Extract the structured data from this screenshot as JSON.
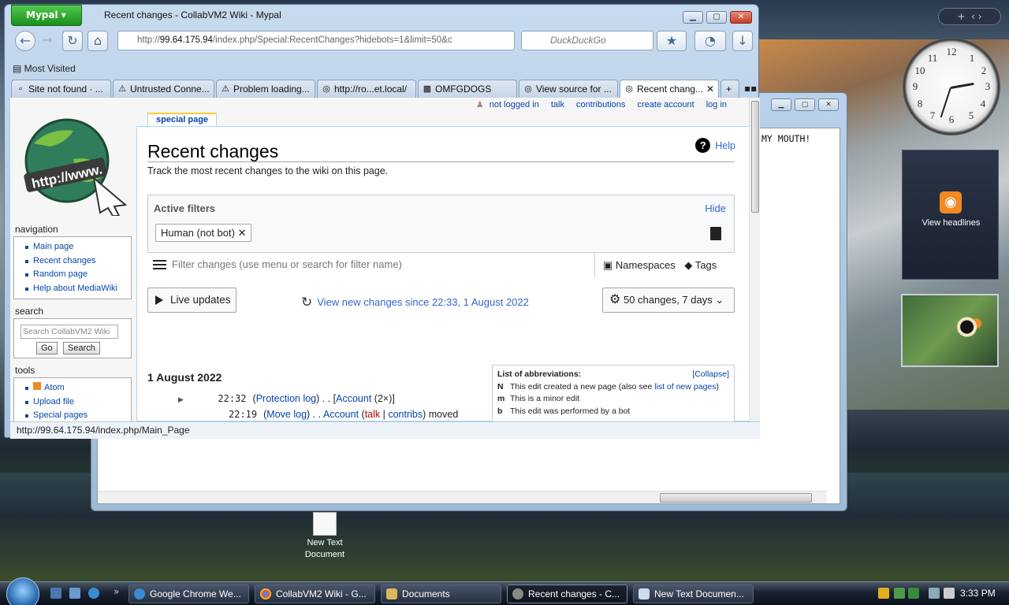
{
  "desktop": {
    "rss_gadget_label": "View headlines",
    "desktop_icon_label_1": "New Text",
    "desktop_icon_label_2": "Document",
    "clock_numerals": [
      "12",
      "1",
      "2",
      "3",
      "4",
      "5",
      "6",
      "7",
      "8",
      "9",
      "10",
      "11"
    ]
  },
  "notepad": {
    "text": "MY MOUTH!"
  },
  "browser": {
    "app_menu": "Mypal",
    "title": "Recent changes - CollabVM2 Wiki - Mypal",
    "url_host": "99.64.175.94",
    "url_prefix": "http://",
    "url_path": "/index.php/Special:RecentChanges?hidebots=1&limit=50&c",
    "search_placeholder": "DuckDuckGo",
    "bookmarks_toolbar": "Most Visited",
    "tabs": [
      {
        "label": "Site not found · ..."
      },
      {
        "label": "Untrusted Conne..."
      },
      {
        "label": "Problem loading..."
      },
      {
        "label": "http://ro...et.local/"
      },
      {
        "label": "OMFGDOGS"
      },
      {
        "label": "View source for ..."
      },
      {
        "label": "Recent chang..."
      }
    ],
    "status_text": "http://99.64.175.94/index.php/Main_Page"
  },
  "wiki": {
    "personal": [
      "not logged in",
      "talk",
      "contributions",
      "create account",
      "log in"
    ],
    "logo_text": "http://www.",
    "special_tab": "special page",
    "page_title": "Recent changes",
    "tagline": "Track the most recent changes to the wiki on this page.",
    "help": "Help",
    "active_filters_label": "Active filters",
    "hide_label": "Hide",
    "filter_chip": "Human (not bot)",
    "filter_placeholder": "Filter changes (use menu or search for filter name)",
    "namespaces": "Namespaces",
    "tags": "Tags",
    "live_updates": "Live updates",
    "view_new": "View new changes since 22:33, 1 August 2022",
    "options": "50 changes, 7 days",
    "day_heading": "1 August 2022",
    "rows": [
      {
        "time": "22:32",
        "log": "Protection log",
        "sep": ") . . [",
        "user": "Account",
        "extra": "(2×)]"
      },
      {
        "time": "22:19",
        "log": "Move log",
        "sep": ") . . ",
        "user": "Account",
        "talk": "talk",
        "contribs": "contribs",
        "tail": ") moved"
      }
    ],
    "abbreviations": {
      "title": "List of abbreviations:",
      "collapse": "[Collapse]",
      "items": [
        {
          "key": "N",
          "text": "This edit created a new page (also see ",
          "link": "list of new pages",
          "end": ")"
        },
        {
          "key": "m",
          "text": "This is a minor edit"
        },
        {
          "key": "b",
          "text": "This edit was performed by a bot"
        }
      ]
    },
    "sidebar": {
      "navigation_heading": "navigation",
      "navigation": [
        "Main page",
        "Recent changes",
        "Random page",
        "Help about MediaWiki"
      ],
      "search_heading": "search",
      "search_placeholder": "Search CollabVM2 Wiki",
      "go": "Go",
      "search": "Search",
      "tools_heading": "tools",
      "tools": [
        "Atom",
        "Upload file",
        "Special pages"
      ]
    }
  },
  "taskbar": {
    "items": [
      {
        "label": "Google Chrome We..."
      },
      {
        "label": "CollabVM2 Wiki - G..."
      },
      {
        "label": "Documents"
      },
      {
        "label": "Recent changes - C..."
      },
      {
        "label": "New Text Documen..."
      }
    ],
    "clock": "3:33 PM"
  },
  "colors": {
    "link": "#0645ad",
    "accent_link": "#3366cc",
    "redlink": "#ba0000",
    "mypal_green": "#2aa52a"
  }
}
